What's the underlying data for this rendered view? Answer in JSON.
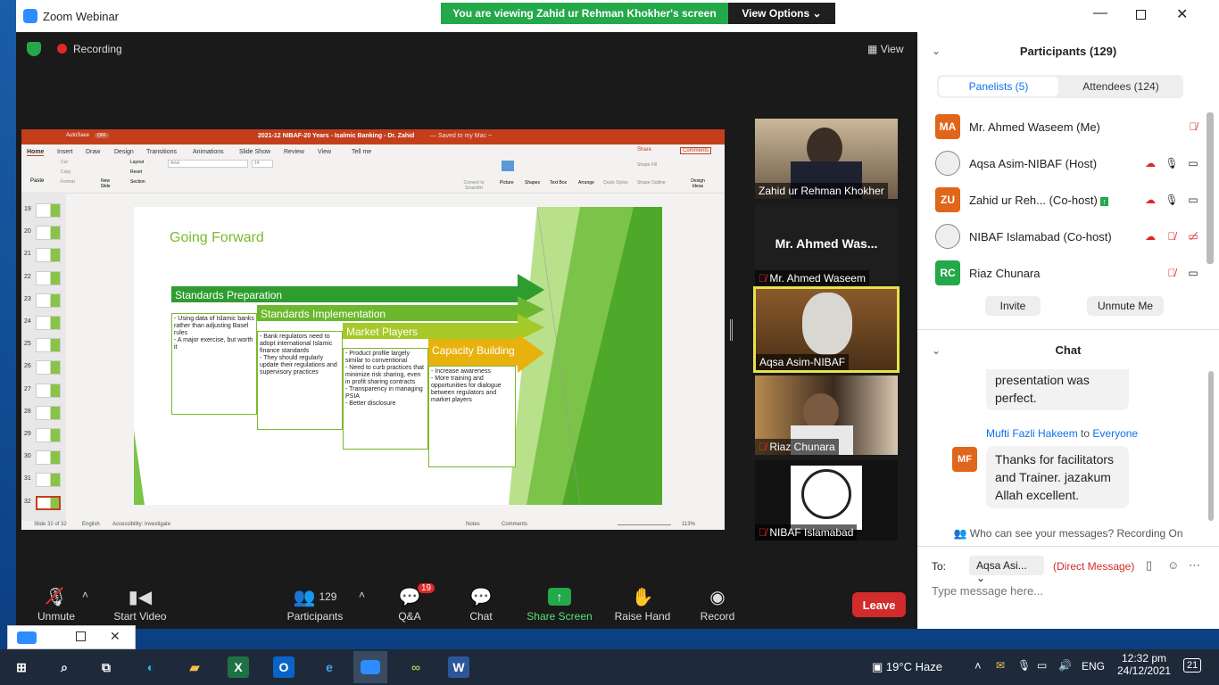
{
  "window": {
    "title": "Zoom Webinar"
  },
  "banner": {
    "text": "You are viewing Zahid ur Rehman Khokher's screen",
    "view_options": "View Options"
  },
  "topbar": {
    "recording": "Recording",
    "view": "View"
  },
  "ppt": {
    "autosave": "AutoSave",
    "autosave_state": "OFF",
    "doc_title": "2021-12 NIBAF-20 Years - Isalmic Banking - Dr. Zahid",
    "saved": "— Saved to my Mac ~",
    "tabs": [
      "Home",
      "Insert",
      "Draw",
      "Design",
      "Transitions",
      "Animations",
      "Slide Show",
      "Review",
      "View",
      "Tell me"
    ],
    "share": "Share",
    "comments": "Comments",
    "ribbon": {
      "paste": "Paste",
      "cut": "Cut",
      "copy": "Copy",
      "format": "Format",
      "new_slide": "New Slide",
      "layout": "Layout",
      "reset": "Reset",
      "section": "Section",
      "font": "Arial",
      "size": "14",
      "convert": "Convert to SmartArt",
      "picture": "Picture",
      "shapes": "Shapes",
      "textbox": "Text Box",
      "arrange": "Arrange",
      "quick_styles": "Quick Styles",
      "shape_fill": "Shape Fill",
      "shape_outline": "Shape Outline",
      "design_ideas": "Design Ideas"
    },
    "thumb_numbers": [
      "19",
      "20",
      "21",
      "22",
      "23",
      "24",
      "25",
      "26",
      "27",
      "28",
      "29",
      "30",
      "31",
      "32"
    ],
    "slide": {
      "title": "Going Forward",
      "stages": [
        {
          "label": "Standards Preparation",
          "bullets": [
            "- Using data of Islamic banks rather than adjusting Basel rules",
            "- A major exercise, but worth it"
          ]
        },
        {
          "label": "Standards Implementation",
          "bullets": [
            "- Bank regulators need to adopt international Islamic finance standards",
            "- They should regularly update their regulations and supervisory practices"
          ]
        },
        {
          "label": "Market Players",
          "bullets": [
            "- Product profile largely similar to conventional",
            "- Need to curb practices that minimize risk sharing, even in profit sharing contracts",
            "- Transparency in managing PSIA",
            "- Better disclosure"
          ]
        },
        {
          "label": "Capacity Building",
          "bullets": [
            "- Increase awareness",
            "- More training and opportunities for dialogue between regulators and market players"
          ]
        }
      ]
    },
    "status": {
      "slide": "Slide 32 of 32",
      "lang": "English",
      "access": "Accessibility: Investigate",
      "notes": "Notes",
      "comments": "Comments",
      "zoom": "113%"
    }
  },
  "videos": [
    {
      "name": "Zahid ur Rehman Khokher"
    },
    {
      "big": "Mr. Ahmed Was...",
      "name": "Mr. Ahmed Waseem"
    },
    {
      "name": "Aqsa Asim-NIBAF"
    },
    {
      "name": "Riaz Chunara"
    },
    {
      "name": "NIBAF Islamabad"
    }
  ],
  "controls": {
    "unmute": "Unmute",
    "start_video": "Start Video",
    "participants": "Participants",
    "participants_count": "129",
    "qa": "Q&A",
    "qa_badge": "19",
    "chat": "Chat",
    "share": "Share Screen",
    "raise": "Raise Hand",
    "record": "Record",
    "leave": "Leave"
  },
  "participants": {
    "header": "Participants (129)",
    "tab_panelists": "Panelists (5)",
    "tab_attendees": "Attendees (124)",
    "list": [
      {
        "initials": "MA",
        "name": "Mr. Ahmed Waseem (Me)",
        "color": "#e0661b"
      },
      {
        "initials": "",
        "name": "Aqsa Asim-NIBAF (Host)",
        "color": "#eee"
      },
      {
        "initials": "ZU",
        "name": "Zahid ur Reh... (Co-host)",
        "color": "#e0661b"
      },
      {
        "initials": "",
        "name": "NIBAF Islamabad (Co-host)",
        "color": "#eee"
      },
      {
        "initials": "RC",
        "name": "Riaz Chunara",
        "color": "#23a84a"
      }
    ],
    "invite": "Invite",
    "unmute_me": "Unmute Me"
  },
  "chat": {
    "header": "Chat",
    "msg1": "presentation was perfect.",
    "sender": "Mufti Fazli Hakeem",
    "to": "to",
    "recipient": "Everyone",
    "sender_initials": "MF",
    "msg2": "Thanks for facilitators and Trainer. jazakum Allah excellent.",
    "notice": "Who can see your messages? Recording On",
    "to_label": "To:",
    "to_value": "Aqsa Asi...",
    "direct": "(Direct Message)",
    "placeholder": "Type message here..."
  },
  "taskbar": {
    "weather": "19°C  Haze",
    "lang": "ENG",
    "time": "12:32 pm",
    "date": "24/12/2021",
    "notif": "21"
  }
}
